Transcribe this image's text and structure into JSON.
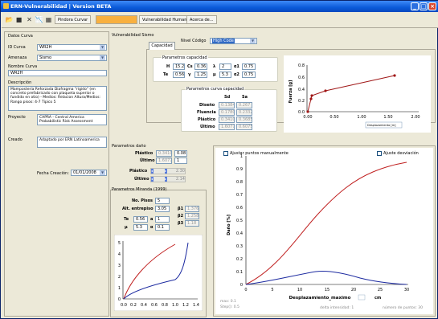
{
  "window": {
    "title": "ERN-Vulnerabilidad | Version BETA"
  },
  "toolbar": {
    "tabs": [
      "Pindora Curvar",
      "Vulnerabilidad Humana",
      "Acerca de..."
    ]
  },
  "datos_curva": {
    "title": "Datos Curva",
    "id_label": "ID Curva",
    "id_value": "WR2H",
    "amenaza_label": "Amenaza",
    "amenaza_value": "Sismo",
    "nombre_label": "Nombre Curva",
    "nombre_value": "WR2H",
    "descripcion_label": "Descripción",
    "descripcion_value": "Mampostería Reforzada Diafragma \"rígido\" (en concreto prefabricado con plaqueta superior o fundido en otio) - Medios: Relacion Altura/Medios: Rango pisos: 4-7 Tipico 5",
    "proyecto_label": "Proyecto",
    "proyecto_value": "CAPRA - Central America Probabilistic Risk Assessment",
    "creado_label": "Creado",
    "creado_value": "Adaptado por ERN Latinoamerica",
    "fecha_label": "Fecha Creación:",
    "fecha_value": "01/01/2008"
  },
  "vuln": {
    "title": "Vulnerabilidad Sismo",
    "tab_capacidad": "Capacidad",
    "nivel_label": "Nivel Código",
    "nivel_value": "High Code",
    "params_cap": {
      "title": "Parametros capacidad",
      "row1": {
        "H_label": "H",
        "H": "15.2",
        "Cs_label": "Cs",
        "Cs": "0.36",
        "l_label": "λ",
        "l": "2",
        "a1_label": "α1",
        "a1": "0.75"
      },
      "row2": {
        "Te_label": "Te",
        "Te": "0.56",
        "g_label": "γ",
        "g": "1.25",
        "mu_label": "μ",
        "mu": "5.3",
        "a2_label": "α2",
        "a2": "0.75"
      }
    },
    "params_curva": {
      "title": "Parametros curva capacidad",
      "col1": "Sd",
      "col2": "Sa",
      "rows": [
        {
          "label": "Diseño",
          "sd": "0.1384",
          "sa": "0.267"
        },
        {
          "label": "Fluencia",
          "sd": "0.1780",
          "sa": "0.2332"
        },
        {
          "label": "Plástico",
          "sd": "0.3410",
          "sa": "0.3685"
        },
        {
          "label": "Último",
          "sd": "1.6077",
          "sa": "0.6075"
        }
      ]
    }
  },
  "capacity_chart": {
    "ylabel": "Fuerza [g]",
    "yticks": [
      "0.0",
      "0.2",
      "0.4",
      "0.6",
      "0.8"
    ],
    "xticks": [
      "0.00",
      "0.50",
      "1.00",
      "1.50",
      "2.00"
    ],
    "unit": "Desplazamiento [m]"
  },
  "dano": {
    "title": "Parametros daño",
    "plastico_label": "Plástico",
    "plastico_v1": "0.3410",
    "plastico_v2": "0.08",
    "ultimo_label": "Último",
    "ultimo_v1": "1.6077",
    "ultimo_v2": "1",
    "plast2_label": "Plástico",
    "plast2_value": "2.30",
    "ult2_label": "Último",
    "ult2_value": "2.14"
  },
  "miranda": {
    "title": "Parametros Miranda (1999)",
    "npisos_label": "No. Pisos",
    "npisos": "5",
    "alt_label": "Alt. entrepiso",
    "alt": "3.05",
    "b1_label": "β1",
    "b1": "1.376",
    "b2_label": "β2",
    "b2": "1.258",
    "b3_label": "β3",
    "b3": "1.18",
    "te_label": "Te",
    "te": "0.56",
    "a_label": "a",
    "a": "1",
    "mu_label": "μ",
    "mu": "5.3",
    "alpha_label": "α",
    "alpha": "0.1"
  },
  "miranda_chart": {
    "yticks": [
      "0",
      "1",
      "2",
      "3",
      "4",
      "5"
    ],
    "xticks": [
      "0.0",
      "0.2",
      "0.4",
      "0.6",
      "0.8",
      "1.0",
      "1.2",
      "1.4"
    ]
  },
  "main_chart": {
    "ajustar_label": "Ajustar puntos manualmente",
    "ajuste_label": "Ajuste desviación",
    "ylabel": "Daño [%]",
    "xlabel": "Desplazamiento_maximo",
    "unit_value": "cm",
    "yticks": [
      "0",
      "0.1",
      "0.2",
      "0.3",
      "0.4",
      "0.5",
      "0.6",
      "0.7",
      "0.8",
      "0.9",
      "1"
    ],
    "xticks": [
      "0",
      "5",
      "10",
      "15",
      "20",
      "25",
      "30"
    ],
    "footer_max": "max: 0.1",
    "footer_step": "Step(): 0.5",
    "footer_delta": "delta intensidad: 1",
    "footer_points": "número de puntos: 30"
  }
}
